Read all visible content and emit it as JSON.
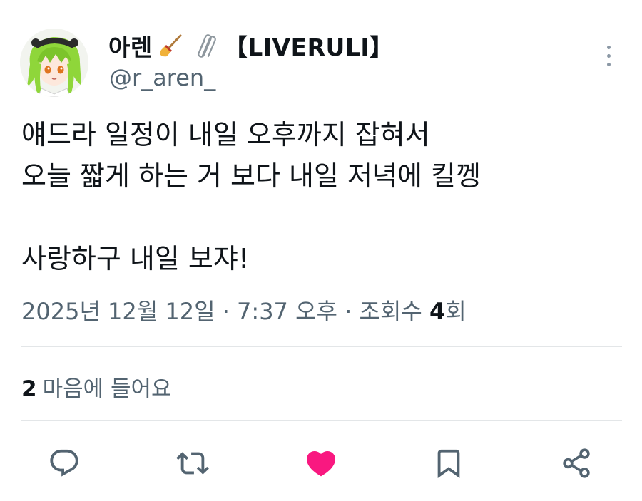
{
  "author": {
    "display_name": "아렌",
    "brand_tag": "【LIVERULI】",
    "handle": "@r_aren_",
    "emojis": [
      "broom-emoji",
      "paperclip-emoji"
    ]
  },
  "tweet": {
    "lines": [
      "얘드라 일정이 내일 오후까지 잡혀서",
      "오늘 짧게 하는 거 보다 내일 저녁에 킬껭",
      "",
      "사랑하구 내일 보쟈!"
    ]
  },
  "meta": {
    "date_time": "2025년 12월 12일 · 7:37 오후 · 조회수 ",
    "views_count": "4",
    "views_suffix": "회"
  },
  "engagement": {
    "likes_count": "2",
    "likes_label": "마음에 들어요"
  },
  "actions": {
    "icons": [
      "reply-icon",
      "retweet-icon",
      "like-icon",
      "bookmark-icon",
      "share-icon"
    ],
    "like_active": true
  },
  "colors": {
    "text_primary": "#0f1419",
    "text_secondary": "#536471",
    "like_pink": "#f91880",
    "icon_gray": "#536471"
  }
}
